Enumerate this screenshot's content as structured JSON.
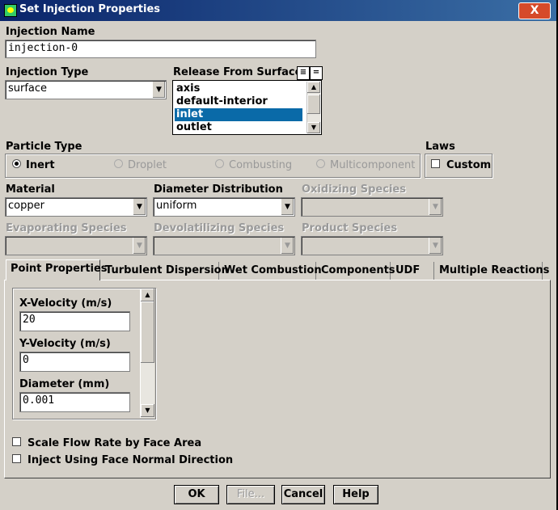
{
  "window": {
    "title": "Set Injection Properties",
    "close_label": "X"
  },
  "injection_name": {
    "label": "Injection Name",
    "value": "injection-0"
  },
  "injection_type": {
    "label": "Injection Type",
    "value": "surface"
  },
  "release_surfaces": {
    "label": "Release From Surfaces",
    "items": [
      "axis",
      "default-interior",
      "inlet",
      "outlet"
    ],
    "selected": "inlet",
    "select_all_icon": "select-all-icon",
    "deselect_all_icon": "deselect-all-icon"
  },
  "particle_type": {
    "label": "Particle Type",
    "options": [
      "Inert",
      "Droplet",
      "Combusting",
      "Multicomponent"
    ],
    "selected": "Inert"
  },
  "laws": {
    "label": "Laws",
    "custom_label": "Custom"
  },
  "material": {
    "label": "Material",
    "value": "copper"
  },
  "diameter_distribution": {
    "label": "Diameter Distribution",
    "value": "uniform"
  },
  "oxidizing_species": {
    "label": "Oxidizing Species",
    "value": ""
  },
  "evaporating_species": {
    "label": "Evaporating Species",
    "value": ""
  },
  "devolatilizing_species": {
    "label": "Devolatilizing Species",
    "value": ""
  },
  "product_species": {
    "label": "Product Species",
    "value": ""
  },
  "tabs": [
    "Point Properties",
    "Turbulent Dispersion",
    "Wet Combustion",
    "Components",
    "UDF",
    "Multiple Reactions"
  ],
  "active_tab": "Point Properties",
  "point_properties": {
    "x_velocity": {
      "label": "X-Velocity (m/s)",
      "value": "20"
    },
    "y_velocity": {
      "label": "Y-Velocity (m/s)",
      "value": "0"
    },
    "diameter": {
      "label": "Diameter (mm)",
      "value": "0.001"
    }
  },
  "options": {
    "scale_flow_rate": "Scale Flow Rate by Face Area",
    "inject_normal": "Inject Using Face Normal Direction"
  },
  "buttons": {
    "ok": "OK",
    "file": "File...",
    "cancel": "Cancel",
    "help": "Help"
  }
}
